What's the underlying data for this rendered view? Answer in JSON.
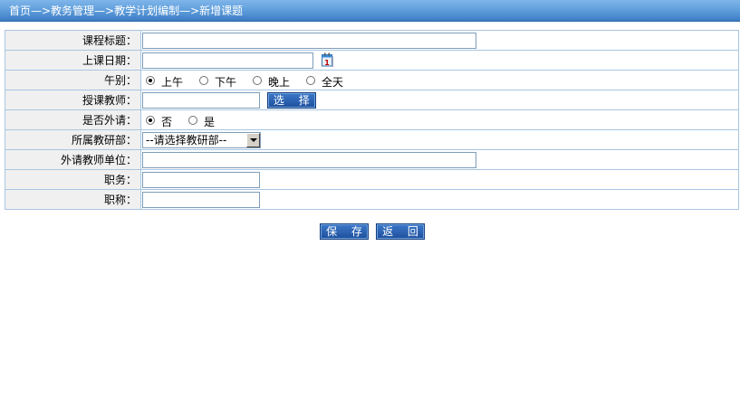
{
  "breadcrumb": "首页—>教务管理—>教学计划编制—>新增课题",
  "form": {
    "course_title": {
      "label": "课程标题：",
      "value": ""
    },
    "class_date": {
      "label": "上课日期：",
      "value": ""
    },
    "session": {
      "label": "午别：",
      "options": [
        "上午",
        "下午",
        "晚上",
        "全天"
      ],
      "selected": "上午"
    },
    "teacher": {
      "label": "授课教师：",
      "value": "",
      "select_button": "选 择"
    },
    "external": {
      "label": "是否外请：",
      "options": [
        "否",
        "是"
      ],
      "selected": "否"
    },
    "department": {
      "label": "所属教研部：",
      "selected_text": "--请选择教研部--"
    },
    "external_unit": {
      "label": "外请教师单位：",
      "value": ""
    },
    "position": {
      "label": "职务：",
      "value": ""
    },
    "title": {
      "label": "职称：",
      "value": ""
    }
  },
  "actions": {
    "save": "保 存",
    "back": "返 回"
  },
  "colors": {
    "titlebar": "#5b9ad9",
    "button": "#2a62b0",
    "border": "#a8c6e2",
    "label_bg": "#f0f0f0"
  },
  "icons": {
    "calendar": "calendar-icon"
  }
}
